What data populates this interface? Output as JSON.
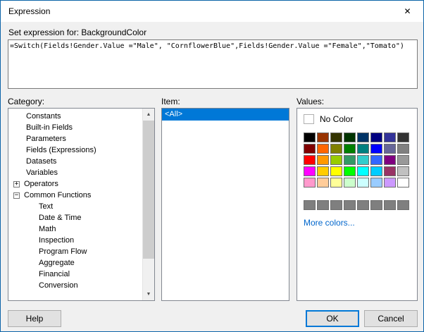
{
  "dialog": {
    "title": "Expression",
    "set_expression_label": "Set expression for: BackgroundColor",
    "expression": "=Switch(Fields!Gender.Value =\"Male\", \"CornflowerBlue\",Fields!Gender.Value =\"Female\",\"Tomato\")"
  },
  "icons": {
    "close": "✕",
    "scroll_up": "▲",
    "scroll_down": "▼"
  },
  "category": {
    "label": "Category:",
    "items": [
      {
        "label": "Constants",
        "level": 1,
        "expander": ""
      },
      {
        "label": "Built-in Fields",
        "level": 1,
        "expander": ""
      },
      {
        "label": "Parameters",
        "level": 1,
        "expander": ""
      },
      {
        "label": "Fields (Expressions)",
        "level": 1,
        "expander": ""
      },
      {
        "label": "Datasets",
        "level": 1,
        "expander": ""
      },
      {
        "label": "Variables",
        "level": 1,
        "expander": ""
      },
      {
        "label": "Operators",
        "level": 0,
        "expander": "+"
      },
      {
        "label": "Common Functions",
        "level": 0,
        "expander": "−"
      },
      {
        "label": "Text",
        "level": 2,
        "expander": ""
      },
      {
        "label": "Date & Time",
        "level": 2,
        "expander": ""
      },
      {
        "label": "Math",
        "level": 2,
        "expander": ""
      },
      {
        "label": "Inspection",
        "level": 2,
        "expander": ""
      },
      {
        "label": "Program Flow",
        "level": 2,
        "expander": ""
      },
      {
        "label": "Aggregate",
        "level": 2,
        "expander": ""
      },
      {
        "label": "Financial",
        "level": 2,
        "expander": ""
      },
      {
        "label": "Conversion",
        "level": 2,
        "expander": ""
      }
    ]
  },
  "item": {
    "label": "Item:",
    "items": [
      {
        "label": "<All>",
        "selected": true
      }
    ]
  },
  "values": {
    "label": "Values:",
    "no_color_label": "No Color",
    "more_colors_label": "More colors...",
    "palette": [
      [
        "#000000",
        "#993300",
        "#333300",
        "#003300",
        "#003366",
        "#000080",
        "#333399",
        "#333333"
      ],
      [
        "#800000",
        "#FF6600",
        "#808000",
        "#008000",
        "#008080",
        "#0000FF",
        "#666699",
        "#808080"
      ],
      [
        "#FF0000",
        "#FF9900",
        "#99CC00",
        "#339966",
        "#33CCCC",
        "#3366FF",
        "#800080",
        "#999999"
      ],
      [
        "#FF00FF",
        "#FFCC00",
        "#FFFF00",
        "#00FF00",
        "#00FFFF",
        "#00CCFF",
        "#993366",
        "#C0C0C0"
      ],
      [
        "#FF99CC",
        "#FFCC99",
        "#FFFF99",
        "#CCFFCC",
        "#CCFFFF",
        "#99CCFF",
        "#CC99FF",
        "#FFFFFF"
      ]
    ],
    "grays": [
      "#7F7F7F",
      "#7F7F7F",
      "#7F7F7F",
      "#7F7F7F",
      "#7F7F7F",
      "#7F7F7F",
      "#7F7F7F",
      "#7F7F7F"
    ]
  },
  "buttons": {
    "help": "Help",
    "ok": "OK",
    "cancel": "Cancel"
  },
  "colors": {
    "accent": "#0078D7",
    "selection": "#0078D7",
    "window_border": "#0C64A8"
  }
}
